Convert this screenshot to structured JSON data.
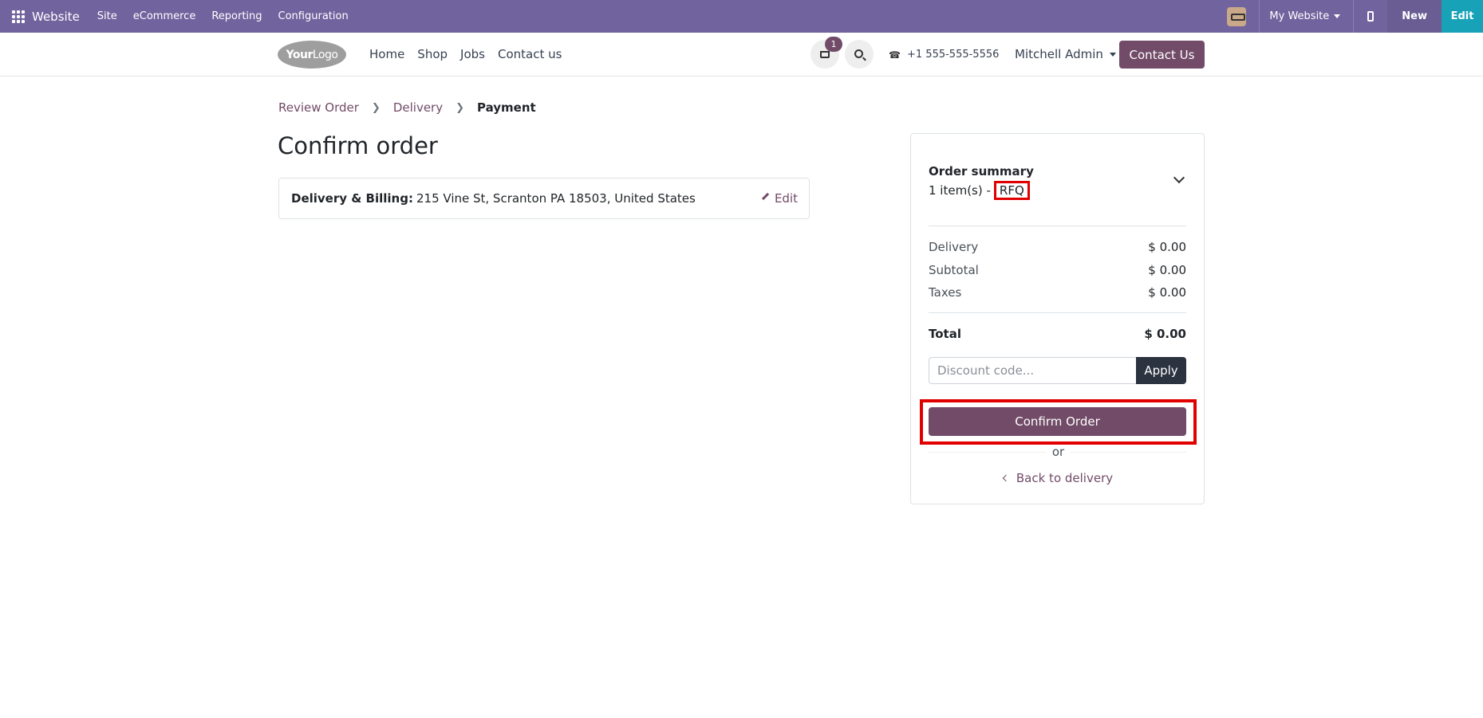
{
  "adminbar": {
    "brand": "Website",
    "menu": [
      "Site",
      "eCommerce",
      "Reporting",
      "Configuration"
    ],
    "website_selector": "My Website",
    "new_label": "New",
    "edit_label": "Edit"
  },
  "header": {
    "logo_text_bold": "Your",
    "logo_text": "Logo",
    "nav": [
      "Home",
      "Shop",
      "Jobs",
      "Contact us"
    ],
    "cart_count": "1",
    "phone": "+1 555-555-5556",
    "user": "Mitchell Admin",
    "contact_button": "Contact Us"
  },
  "breadcrumb": {
    "steps": [
      "Review Order",
      "Delivery"
    ],
    "current": "Payment"
  },
  "page": {
    "title": "Confirm order",
    "address_label": "Delivery & Billing:",
    "address_value": "215 Vine St, Scranton PA 18503, United States",
    "edit_label": "Edit"
  },
  "summary": {
    "title": "Order summary",
    "items_prefix": "1 item(s) -",
    "items_tag": "RFQ",
    "rows": [
      {
        "label": "Delivery",
        "value": "$ 0.00"
      },
      {
        "label": "Subtotal",
        "value": "$ 0.00"
      },
      {
        "label": "Taxes",
        "value": "$ 0.00"
      }
    ],
    "total_label": "Total",
    "total_value": "$ 0.00",
    "discount_placeholder": "Discount code...",
    "apply_label": "Apply",
    "confirm_label": "Confirm Order",
    "or_label": "or",
    "back_label": "Back to delivery"
  },
  "colors": {
    "admin_bar": "#71639e",
    "brand_primary": "#714b67",
    "edit_accent": "#17a2b8",
    "highlight": "#e00000"
  }
}
